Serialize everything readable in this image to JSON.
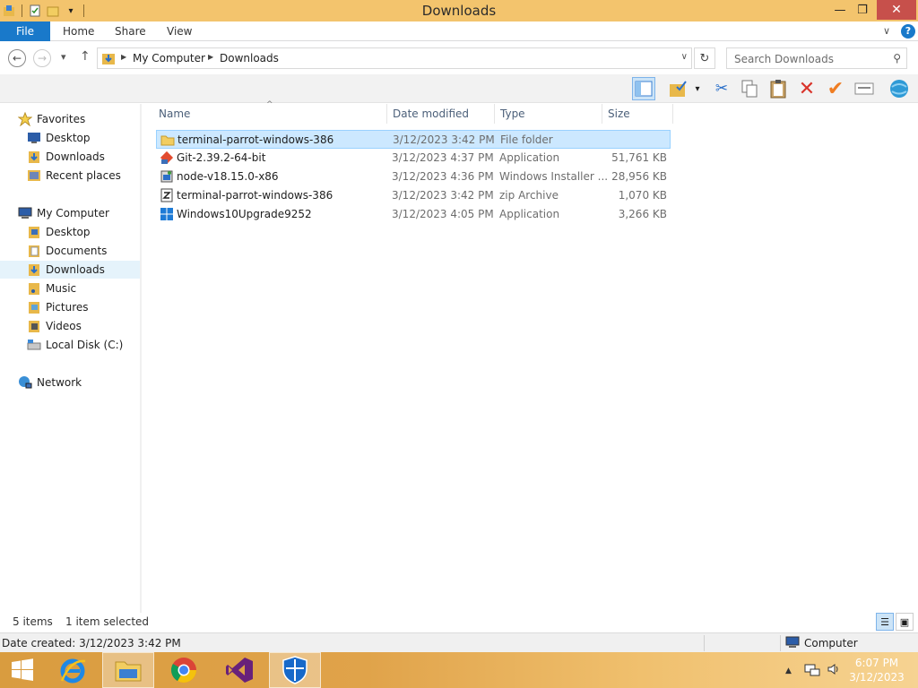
{
  "window": {
    "title": "Downloads",
    "controls": {
      "minimize": "—",
      "maximize": "❐",
      "close": "✕"
    }
  },
  "ribbon": {
    "tabs": [
      {
        "label": "File"
      },
      {
        "label": "Home"
      },
      {
        "label": "Share"
      },
      {
        "label": "View"
      }
    ],
    "help": "?"
  },
  "address": {
    "crumbs": [
      "My Computer",
      "Downloads"
    ]
  },
  "search": {
    "placeholder": "Search Downloads"
  },
  "toolbar": {
    "buttons": [
      "layout-pane-icon",
      "checked-folder-icon",
      "cut-icon",
      "copy-icon",
      "paste-icon",
      "delete-icon",
      "checkmark-icon",
      "rename-icon",
      "globe-icon"
    ]
  },
  "nav": {
    "favorites": "Favorites",
    "favorites_items": [
      "Desktop",
      "Downloads",
      "Recent places"
    ],
    "computer": "My Computer",
    "computer_items": [
      "Desktop",
      "Documents",
      "Downloads",
      "Music",
      "Pictures",
      "Videos",
      "Local Disk (C:)"
    ],
    "selected": "Downloads",
    "network": "Network"
  },
  "files": {
    "columns": [
      "Name",
      "Date modified",
      "Type",
      "Size"
    ],
    "rows": [
      {
        "icon": "folder-icon",
        "name": "terminal-parrot-windows-386",
        "date": "3/12/2023 3:42 PM",
        "type": "File folder",
        "size": "",
        "selected": true
      },
      {
        "icon": "git-icon",
        "name": "Git-2.39.2-64-bit",
        "date": "3/12/2023 4:37 PM",
        "type": "Application",
        "size": "51,761 KB",
        "selected": false
      },
      {
        "icon": "installer-icon",
        "name": "node-v18.15.0-x86",
        "date": "3/12/2023 4:36 PM",
        "type": "Windows Installer ...",
        "size": "28,956 KB",
        "selected": false
      },
      {
        "icon": "zip-icon",
        "name": "terminal-parrot-windows-386",
        "date": "3/12/2023 3:42 PM",
        "type": "zip Archive",
        "size": "1,070 KB",
        "selected": false
      },
      {
        "icon": "windows-logo-icon",
        "name": "Windows10Upgrade9252",
        "date": "3/12/2023 4:05 PM",
        "type": "Application",
        "size": "3,266 KB",
        "selected": false
      }
    ]
  },
  "status": {
    "count": "5 items",
    "selection": "1 item selected"
  },
  "details": {
    "text": "Date created: 3/12/2023 3:42 PM",
    "location": "Computer"
  },
  "taskbar": {
    "apps": [
      "internet-explorer-icon",
      "file-explorer-icon",
      "chrome-icon",
      "visual-studio-icon",
      "defender-shield-icon"
    ],
    "active": "file-explorer-icon",
    "clock_time": "6:07 PM",
    "clock_date": "3/12/2023"
  }
}
